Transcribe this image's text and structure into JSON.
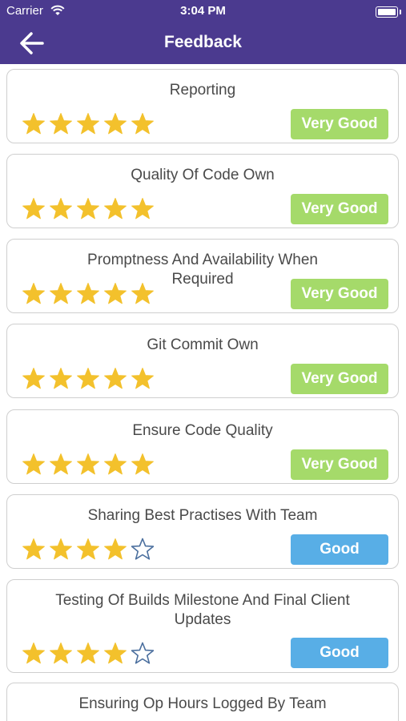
{
  "status_bar": {
    "carrier": "Carrier",
    "time": "3:04 PM"
  },
  "nav": {
    "title": "Feedback"
  },
  "colors": {
    "very_good": "#a5da6a",
    "good": "#58aee6",
    "star_filled": "#f3c12c",
    "star_empty": "#4b6f9e",
    "header": "#4b3a8f"
  },
  "feedback_items": [
    {
      "label": "Reporting",
      "rating": 5,
      "badge": "Very Good"
    },
    {
      "label": "Quality Of Code Own",
      "rating": 5,
      "badge": "Very Good"
    },
    {
      "label": "Promptness And Availability When Required",
      "rating": 5,
      "badge": "Very Good"
    },
    {
      "label": "Git Commit Own",
      "rating": 5,
      "badge": "Very Good"
    },
    {
      "label": "Ensure Code Quality",
      "rating": 5,
      "badge": "Very Good"
    },
    {
      "label": "Sharing Best Practises With Team",
      "rating": 4,
      "badge": "Good"
    },
    {
      "label": "Testing Of Builds Milestone And Final Client Updates",
      "rating": 4,
      "badge": "Good"
    },
    {
      "label": "Ensuring Op Hours Logged By Team",
      "rating": null,
      "badge": ""
    }
  ]
}
